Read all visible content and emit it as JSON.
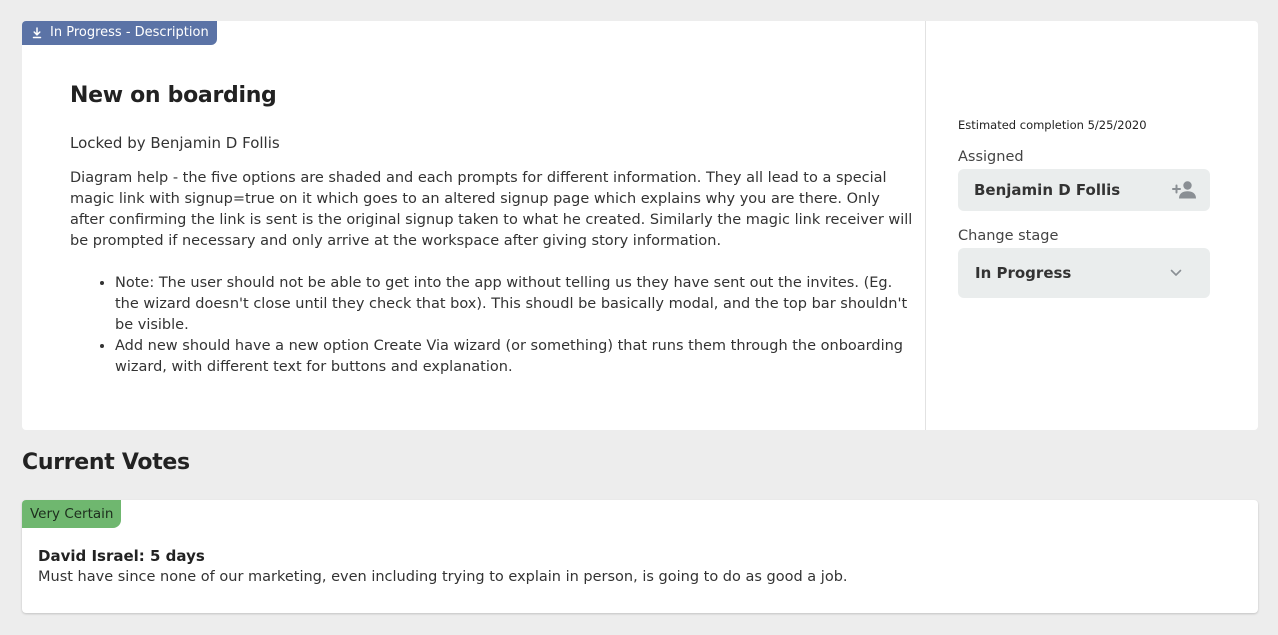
{
  "description_card": {
    "tag_label": "In Progress - Description",
    "tag_icon": "download-arrow-icon",
    "tag_color": "#5b73a6",
    "title": "New on boarding",
    "locked_text": "Locked by Benjamin D Follis",
    "body_paragraph": "Diagram help - the five options are shaded and each prompts for different information. They all lead to a special magic link with signup=true on it which goes to an altered signup page which explains why you are there. Only after confirming the link is sent is the original signup taken to what he created. Similarly the magic link receiver will be prompted if necessary and only arrive at the workspace after giving story information.",
    "bullets": [
      "Note: The user should not be able to get into the app without telling us they have sent out the invites. (Eg. the wizard doesn't close until they check that box). This shoudl be basically modal, and the top bar shouldn't be visible.",
      "Add new should have a new option Create Via wizard (or something) that runs them through the onboarding wizard, with different text for buttons and explanation."
    ]
  },
  "sidebar": {
    "estimated_completion": "Estimated completion 5/25/2020",
    "assigned_label": "Assigned",
    "assignee": "Benjamin D Follis",
    "assign_icon": "add-person-icon",
    "stage_label": "Change stage",
    "stage_value": "In Progress",
    "stage_icon": "chevron-down-icon"
  },
  "votes": {
    "heading": "Current Votes",
    "items": [
      {
        "badge": "Very Certain",
        "badge_color": "#6fb76f",
        "voter": "David Israel: 5 days",
        "comment": "Must have since none of our marketing, even including trying to explain in person, is going to do as good a job."
      }
    ]
  }
}
